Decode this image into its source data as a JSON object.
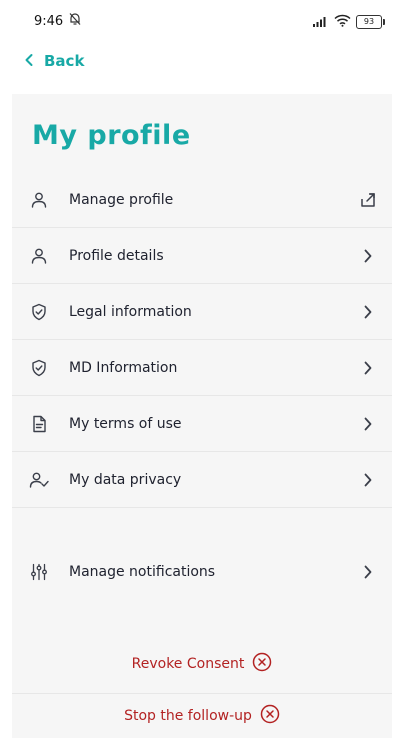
{
  "status_bar": {
    "time": "9:46",
    "battery": "93"
  },
  "nav": {
    "back_label": "Back"
  },
  "page": {
    "title": "My profile"
  },
  "menu": {
    "items": [
      {
        "label": "Manage profile",
        "icon": "user-icon",
        "trailing": "external-link-icon"
      },
      {
        "label": "Profile details",
        "icon": "user-icon",
        "trailing": "chevron-right-icon"
      },
      {
        "label": "Legal information",
        "icon": "shield-check-icon",
        "trailing": "chevron-right-icon"
      },
      {
        "label": "MD Information",
        "icon": "shield-check-icon",
        "trailing": "chevron-right-icon"
      },
      {
        "label": "My terms of use",
        "icon": "document-icon",
        "trailing": "chevron-right-icon"
      },
      {
        "label": "My data privacy",
        "icon": "user-check-icon",
        "trailing": "chevron-right-icon"
      }
    ],
    "notifications": {
      "label": "Manage notifications",
      "icon": "sliders-icon",
      "trailing": "chevron-right-icon"
    }
  },
  "actions": {
    "revoke_consent": "Revoke Consent",
    "stop_follow_up": "Stop the follow-up"
  },
  "colors": {
    "accent": "#18a9a6",
    "danger": "#b32222",
    "panel_background": "#f6f6f6"
  }
}
